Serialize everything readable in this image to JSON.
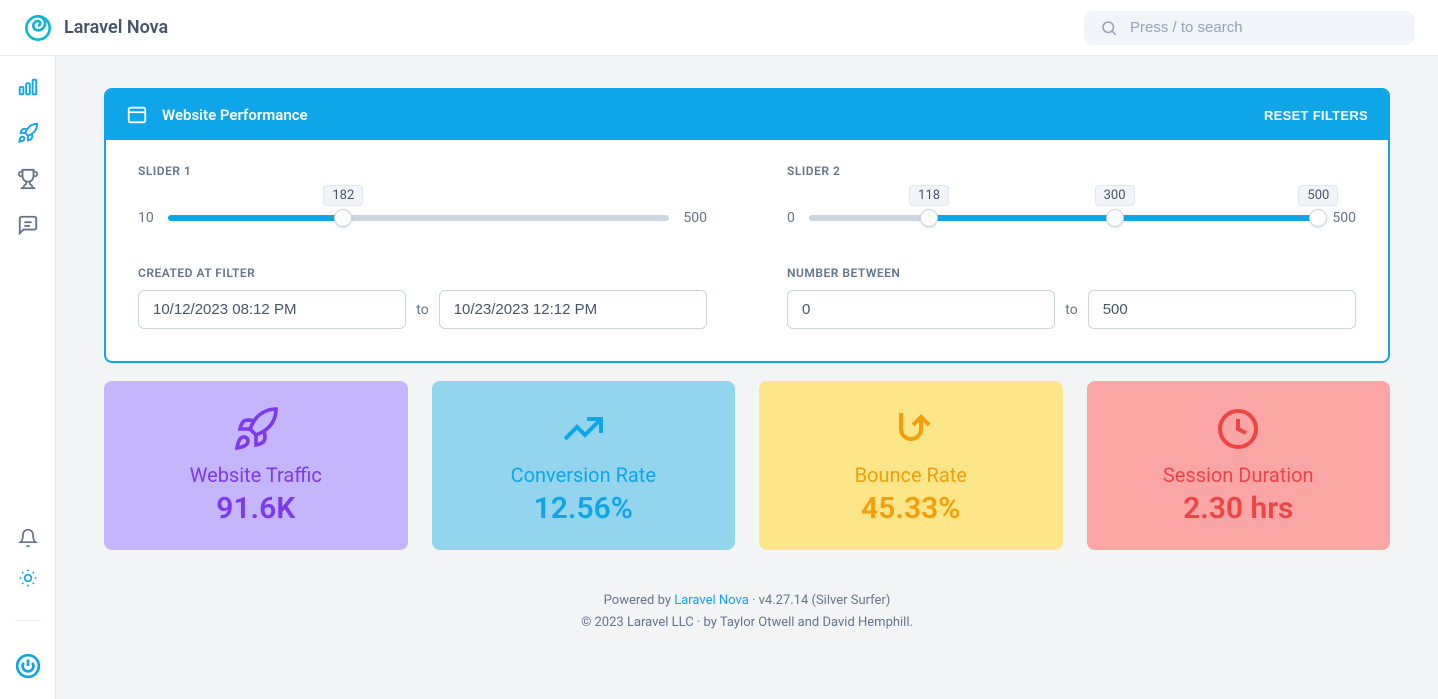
{
  "brand": "Laravel Nova",
  "search": {
    "placeholder": "Press / to search"
  },
  "panel": {
    "title": "Website Performance",
    "reset_label": "RESET FILTERS"
  },
  "filters": {
    "slider1": {
      "label": "SLIDER 1",
      "min": "10",
      "max": "500",
      "value": "182"
    },
    "slider2": {
      "label": "SLIDER 2",
      "min": "0",
      "max": "500",
      "v1": "118",
      "v2": "300",
      "v3": "500"
    },
    "created_at": {
      "label": "CREATED AT FILTER",
      "from": "10/12/2023 08:12 PM",
      "to": "10/23/2023 12:12 PM",
      "to_label": "to"
    },
    "number_between": {
      "label": "NUMBER BETWEEN",
      "from": "0",
      "to": "500",
      "to_label": "to"
    }
  },
  "cards": {
    "traffic": {
      "title": "Website Traffic",
      "value": "91.6K"
    },
    "conversion": {
      "title": "Conversion Rate",
      "value": "12.56%"
    },
    "bounce": {
      "title": "Bounce Rate",
      "value": "45.33%"
    },
    "session": {
      "title": "Session Duration",
      "value": "2.30 hrs"
    }
  },
  "footer": {
    "powered_prefix": "Powered by ",
    "powered_link": "Laravel Nova",
    "version": " · v4.27.14 (Silver Surfer)",
    "copyright": "© 2023 Laravel LLC · by Taylor Otwell and David Hemphill."
  }
}
